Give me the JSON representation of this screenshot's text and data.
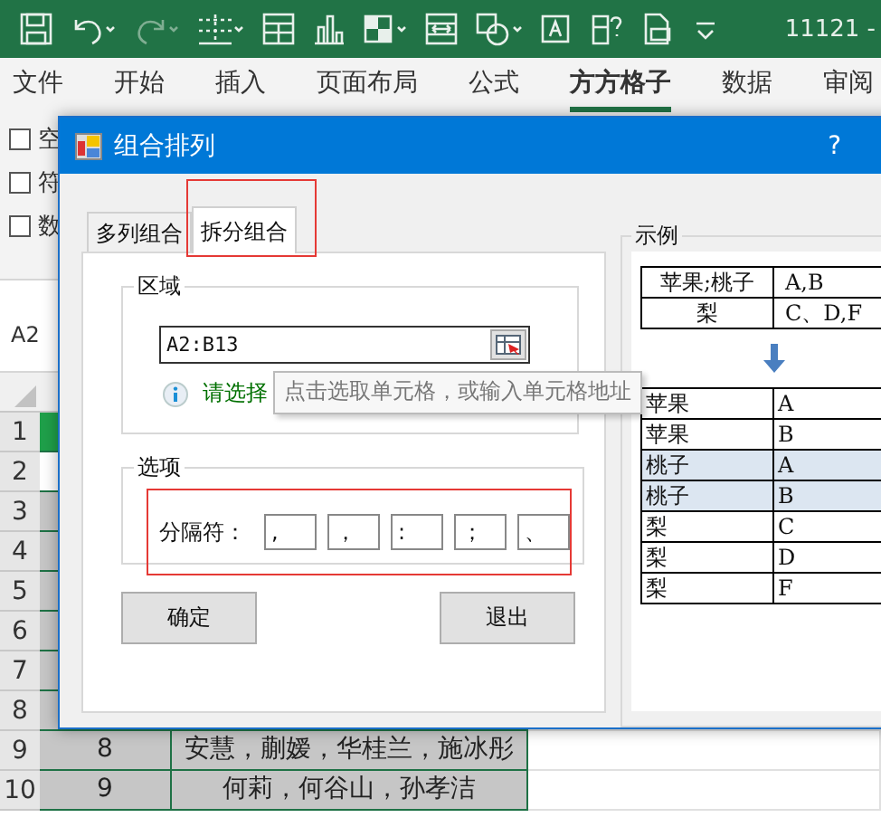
{
  "window": {
    "title": "11121 -"
  },
  "ribbon": {
    "tabs": [
      {
        "label": "文件",
        "selected": false
      },
      {
        "label": "开始",
        "selected": false
      },
      {
        "label": "插入",
        "selected": false
      },
      {
        "label": "页面布局",
        "selected": false
      },
      {
        "label": "公式",
        "selected": false
      },
      {
        "label": "方方格子",
        "selected": true
      },
      {
        "label": "数据",
        "selected": false
      },
      {
        "label": "审阅",
        "selected": false
      }
    ],
    "checkboxes": [
      {
        "label": "空",
        "checked": false
      },
      {
        "label": "符",
        "checked": false
      },
      {
        "label": "数",
        "checked": false
      }
    ]
  },
  "name_box": "A2",
  "sheet": {
    "rows": [
      {
        "header": "1",
        "kind": "header"
      },
      {
        "header": "2",
        "kind": "active"
      },
      {
        "header": "3",
        "kind": "selected"
      },
      {
        "header": "4",
        "kind": "selected"
      },
      {
        "header": "5",
        "kind": "selected"
      },
      {
        "header": "6",
        "kind": "selected"
      },
      {
        "header": "7",
        "kind": "selected"
      },
      {
        "header": "8",
        "kind": "selected"
      },
      {
        "header": "9",
        "kind": "selected",
        "cells": [
          "8",
          "安慧，蒯嫒，华桂兰，施冰彤"
        ]
      },
      {
        "header": "10",
        "kind": "selected",
        "cells": [
          "9",
          "何莉，何谷山，孙孝洁"
        ]
      }
    ]
  },
  "dialog": {
    "title": "组合排列",
    "help": "?",
    "tabs": [
      {
        "label": "多列组合",
        "selected": false
      },
      {
        "label": "拆分组合",
        "selected": true
      }
    ],
    "region": {
      "title": "区域",
      "range_field": {
        "value": "A2:B13"
      },
      "hint": "请选择"
    },
    "tooltip": "点击选取单元格，或输入单元格地址",
    "options": {
      "title": "选项",
      "separator_label": "分隔符：",
      "separators": [
        ",",
        "，",
        ":",
        "；",
        "、"
      ]
    },
    "buttons": [
      "确定",
      "退出"
    ],
    "example": {
      "title": "示例",
      "source_rows": [
        [
          "苹果;桃子",
          "A,B"
        ],
        [
          "梨",
          "C、D,F"
        ]
      ],
      "result_rows": [
        {
          "cells": [
            "苹果",
            "A"
          ],
          "highlighted": false
        },
        {
          "cells": [
            "苹果",
            "B"
          ],
          "highlighted": false
        },
        {
          "cells": [
            "桃子",
            "A"
          ],
          "highlighted": true
        },
        {
          "cells": [
            "桃子",
            "B"
          ],
          "highlighted": true
        },
        {
          "cells": [
            "梨",
            "C"
          ],
          "highlighted": false
        },
        {
          "cells": [
            "梨",
            "D"
          ],
          "highlighted": false
        },
        {
          "cells": [
            "梨",
            "F"
          ],
          "highlighted": false
        }
      ]
    }
  }
}
